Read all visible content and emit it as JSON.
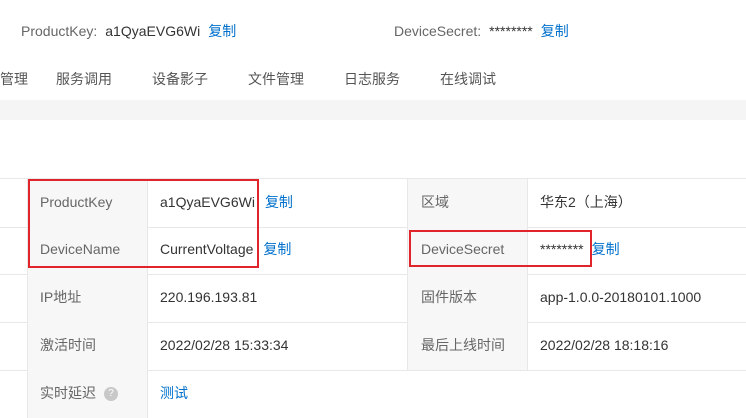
{
  "header": {
    "product_key_label": "ProductKey:",
    "product_key_value": "a1QyaEVG6Wi",
    "product_key_copy": "复制",
    "device_secret_label": "DeviceSecret:",
    "device_secret_value": "********",
    "device_secret_copy": "复制"
  },
  "tabs": [
    "管理",
    "服务调用",
    "设备影子",
    "文件管理",
    "日志服务",
    "在线调试"
  ],
  "info": {
    "product_key": {
      "label": "ProductKey",
      "value": "a1QyaEVG6Wi",
      "copy": "复制"
    },
    "region": {
      "label": "区域",
      "value": "华东2（上海）"
    },
    "device_name": {
      "label": "DeviceName",
      "value": "CurrentVoltage",
      "copy": "复制"
    },
    "device_secret": {
      "label": "DeviceSecret",
      "value": "********",
      "copy": "复制"
    },
    "ip": {
      "label": "IP地址",
      "value": "220.196.193.81"
    },
    "firmware": {
      "label": "固件版本",
      "value": "app-1.0.0-20180101.1000"
    },
    "activated": {
      "label": "激活时间",
      "value": "2022/02/28 15:33:34"
    },
    "last_online": {
      "label": "最后上线时间",
      "value": "2022/02/28 18:18:16"
    },
    "latency": {
      "label": "实时延迟",
      "help_icon": "?",
      "action": "测试"
    }
  },
  "colors": {
    "link": "#0070cc",
    "highlight": "#e0242c",
    "label_bg": "#f7f7f7"
  }
}
